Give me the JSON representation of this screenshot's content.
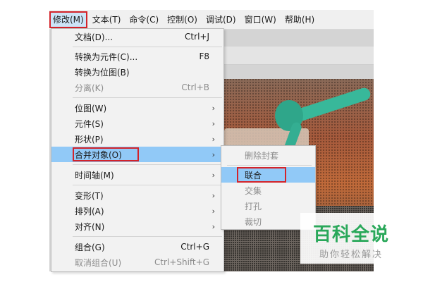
{
  "colors": {
    "highlight": "#91c9f7",
    "annotation_red": "#d3232a",
    "watermark_green": "#2aa85a"
  },
  "menubar": {
    "items": [
      {
        "label": "修改(M)",
        "active": true
      },
      {
        "label": "文本(T)"
      },
      {
        "label": "命令(C)"
      },
      {
        "label": "控制(O)"
      },
      {
        "label": "调试(D)"
      },
      {
        "label": "窗口(W)"
      },
      {
        "label": "帮助(H)"
      }
    ]
  },
  "modify_menu": {
    "items": {
      "document": {
        "label": "文档(D)...",
        "shortcut": "Ctrl+J"
      },
      "convert_symbol": {
        "label": "转换为元件(C)...",
        "shortcut": "F8"
      },
      "convert_bitmap": {
        "label": "转换为位图(B)"
      },
      "break_apart": {
        "label": "分离(K)",
        "shortcut": "Ctrl+B"
      },
      "bitmap": {
        "label": "位图(W)",
        "arrow": "›"
      },
      "symbol": {
        "label": "元件(S)",
        "arrow": "›"
      },
      "shape": {
        "label": "形状(P)",
        "arrow": "›"
      },
      "combine_objects": {
        "label": "合并对象(O)",
        "arrow": "›"
      },
      "timeline": {
        "label": "时间轴(M)",
        "arrow": "›"
      },
      "transform": {
        "label": "变形(T)",
        "arrow": "›"
      },
      "arrange": {
        "label": "排列(A)",
        "arrow": "›"
      },
      "align": {
        "label": "对齐(N)",
        "arrow": "›"
      },
      "group": {
        "label": "组合(G)",
        "shortcut": "Ctrl+G"
      },
      "ungroup": {
        "label": "取消组合(U)",
        "shortcut": "Ctrl+Shift+G"
      }
    }
  },
  "combine_submenu": {
    "items": {
      "delete_envelope": {
        "label": "删除封套"
      },
      "union": {
        "label": "联合"
      },
      "intersect": {
        "label": "交集"
      },
      "punch": {
        "label": "打孔"
      },
      "crop": {
        "label": "裁切"
      }
    }
  },
  "watermark": {
    "title": "百科全说",
    "subtitle": "助你轻松解决"
  }
}
